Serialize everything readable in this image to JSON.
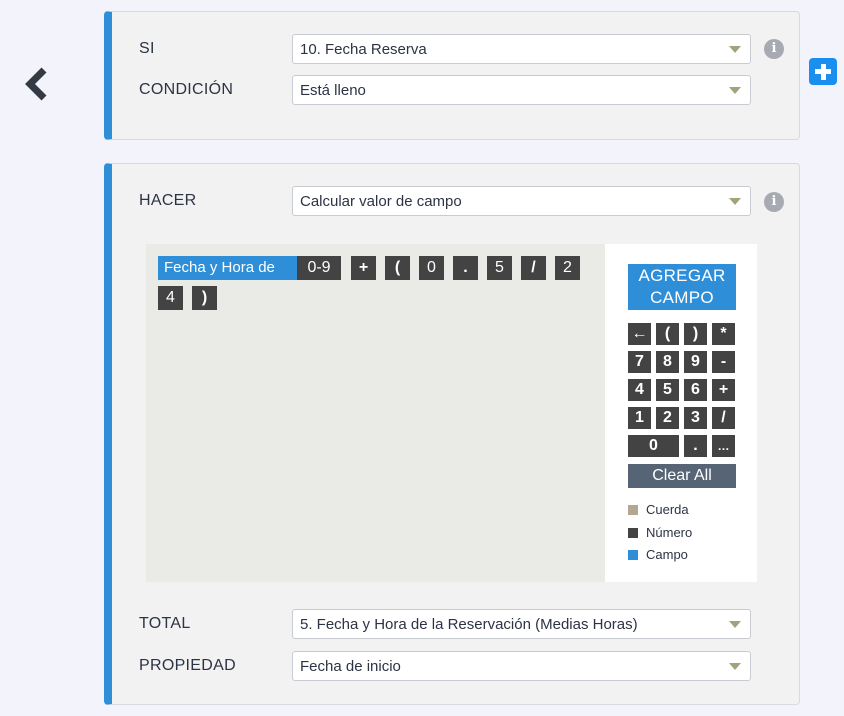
{
  "condition_block": {
    "si_label": "SI",
    "si_value": "10. Fecha Reserva",
    "condicion_label": "CONDICIÓN",
    "condicion_value": "Está lleno"
  },
  "action_block": {
    "hacer_label": "HACER",
    "hacer_value": "Calcular valor de campo",
    "total_label": "TOTAL",
    "total_value": "5. Fecha y Hora de la Reservación (Medias Horas)",
    "propiedad_label": "PROPIEDAD",
    "propiedad_value": "Fecha de inicio"
  },
  "formula_tokens": [
    {
      "text": "Fecha y Hora de",
      "kind": "field"
    },
    {
      "text": "0-9",
      "kind": "number"
    },
    {
      "text": "+",
      "kind": "number"
    },
    {
      "text": "(",
      "kind": "number"
    },
    {
      "text": "0",
      "kind": "number"
    },
    {
      "text": ".",
      "kind": "number"
    },
    {
      "text": "5",
      "kind": "number"
    },
    {
      "text": "/",
      "kind": "number"
    },
    {
      "text": "2",
      "kind": "number"
    },
    {
      "text": "4",
      "kind": "number"
    },
    {
      "text": ")",
      "kind": "number"
    }
  ],
  "keypad": {
    "add_field_label": "AGREGAR CAMPO",
    "keys": [
      "←",
      "(",
      ")",
      "*",
      "7",
      "8",
      "9",
      "-",
      "4",
      "5",
      "6",
      "+",
      "1",
      "2",
      "3",
      "/",
      "0",
      ".",
      "…"
    ],
    "clear_all_label": "Clear All"
  },
  "legend": [
    {
      "label": "Cuerda",
      "color": "#b3a792"
    },
    {
      "label": "Número",
      "color": "#434343"
    },
    {
      "label": "Campo",
      "color": "#2e8fd8"
    }
  ],
  "icons": {
    "back": "chevron-left-icon",
    "info": "info-icon",
    "add": "plus-icon"
  },
  "info_glyph": "i",
  "colors": {
    "accent": "#2e8fd8",
    "add_button": "#1a8ff0",
    "key": "#434343",
    "clear": "#566475"
  }
}
